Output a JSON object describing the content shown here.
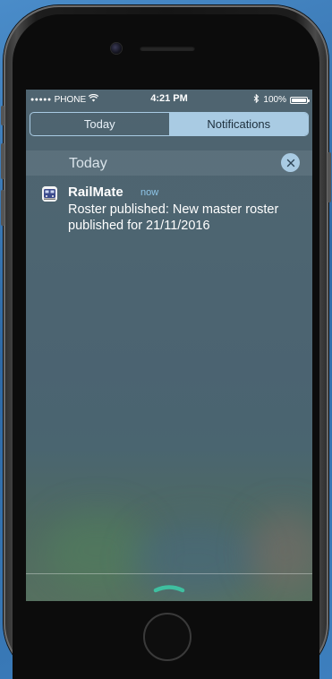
{
  "status_bar": {
    "carrier": "PHONE",
    "time": "4:21 PM",
    "battery": "100%",
    "battery_level": 1.0,
    "icons": [
      "signal-dots-icon",
      "wifi-icon",
      "bluetooth-icon",
      "battery-icon"
    ]
  },
  "tabs": [
    {
      "label": "Today",
      "selected": false
    },
    {
      "label": "Notifications",
      "selected": true
    }
  ],
  "section": {
    "title": "Today",
    "clear_icon": "close-icon"
  },
  "notification": {
    "app_name": "RailMate",
    "time": "now",
    "body": "Roster published: New master roster published for 21/11/2016",
    "icon": "train-app-icon"
  },
  "colors": {
    "accent": "#a9cbe3",
    "time_text": "#8ec5e8",
    "grabber": "#3fbfa0"
  }
}
